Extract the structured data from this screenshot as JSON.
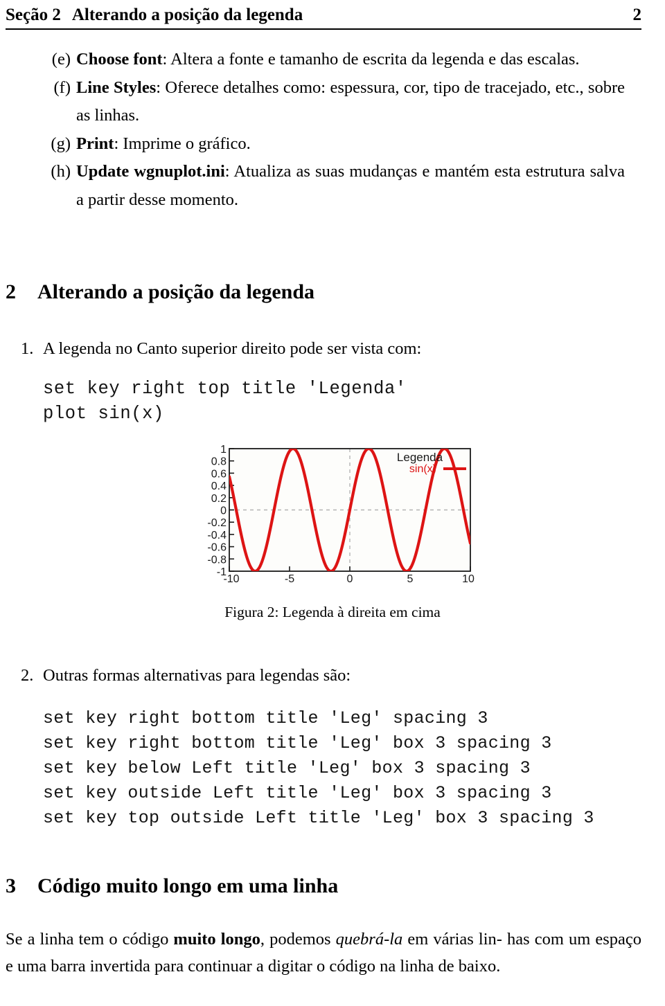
{
  "header": {
    "section_label": "Seção 2",
    "title": "Alterando a posição da legenda",
    "page_number": "2"
  },
  "lettered_list": [
    {
      "marker": "(e)",
      "bold": "Choose font",
      "rest": ": Altera a fonte e tamanho de escrita da legenda e das escalas."
    },
    {
      "marker": "(f)",
      "bold": "Line Styles",
      "rest": ": Oferece detalhes como: espessura, cor, tipo de tracejado, etc., sobre as linhas."
    },
    {
      "marker": "(g)",
      "bold": "Print",
      "rest": ": Imprime o gráfico."
    },
    {
      "marker": "(h)",
      "bold": "Update wgnuplot.ini",
      "rest": ": Atualiza as suas mudanças e mantém esta estrutura salva a partir desse momento."
    }
  ],
  "section_2": {
    "number": "2",
    "title": "Alterando a posição da legenda",
    "item_1": {
      "marker": "1.",
      "text": "A legenda no Canto superior direito pode ser vista com:"
    },
    "code_1": "set key right top title 'Legenda'\nplot sin(x)",
    "item_2": {
      "marker": "2.",
      "text": "Outras formas alternativas para legendas são:"
    },
    "code_2": "set key right bottom title 'Leg' spacing 3\nset key right bottom title 'Leg' box 3 spacing 3\nset key below Left title 'Leg' box 3 spacing 3\nset key outside Left title 'Leg' box 3 spacing 3\nset key top outside Left title 'Leg' box 3 spacing 3"
  },
  "figure": {
    "caption": "Figura 2: Legenda à direita em cima",
    "legend_title": "Legenda",
    "legend_entry": "sin(x)",
    "curve_color": "#dd1414",
    "frame_color": "#1a1a1a",
    "grid_color": "#b4b4b4",
    "plot_background": "#fdfdfb"
  },
  "section_3": {
    "number": "3",
    "title": "Código muito longo em uma linha"
  },
  "closing_paragraph": {
    "line_1_a": "Se a linha tem o código ",
    "line_1_bold": "muito longo",
    "line_1_b": ", podemos ",
    "line_1_italic": "quebrá-la",
    "line_1_c": " em várias lin-",
    "line_2": "has com um espaço e uma barra invertida para continuar a digitar o",
    "line_3": "código na linha de baixo."
  },
  "chart_data": {
    "type": "line",
    "title": "",
    "xlabel": "",
    "ylabel": "",
    "xlim": [
      -10,
      10
    ],
    "ylim": [
      -1,
      1
    ],
    "xticks": [
      -10,
      -5,
      0,
      5,
      10
    ],
    "yticks": [
      1,
      0.8,
      0.6,
      0.4,
      0.2,
      0,
      -0.2,
      -0.4,
      -0.6,
      -0.8,
      -1
    ],
    "xtick_labels": [
      "-10",
      "-5",
      "0",
      "5",
      "10"
    ],
    "ytick_labels": [
      "1",
      "0.8",
      "0.6",
      "0.4",
      "0.2",
      "0",
      "-0.2",
      "-0.4",
      "-0.6",
      "-0.8",
      "-1"
    ],
    "grid": true,
    "legend_position": "right top",
    "legend_title": "Legenda",
    "series": [
      {
        "name": "sin(x)",
        "color": "#dd1414",
        "function": "sin(x)",
        "x": [
          -10,
          -9.5,
          -9,
          -8.5,
          -8,
          -7.5,
          -7,
          -6.5,
          -6,
          -5.5,
          -5,
          -4.5,
          -4,
          -3.5,
          -3,
          -2.5,
          -2,
          -1.5,
          -1,
          -0.5,
          0,
          0.5,
          1,
          1.5,
          2,
          2.5,
          3,
          3.5,
          4,
          4.5,
          5,
          5.5,
          6,
          6.5,
          7,
          7.5,
          8,
          8.5,
          9,
          9.5,
          10
        ],
        "y": [
          0.544,
          0.075,
          -0.412,
          -0.798,
          -0.989,
          -0.938,
          -0.657,
          -0.215,
          0.279,
          0.706,
          0.959,
          0.978,
          0.757,
          0.351,
          -0.141,
          -0.598,
          -0.909,
          -0.997,
          -0.841,
          -0.479,
          0,
          0.479,
          0.841,
          0.997,
          0.909,
          0.598,
          0.141,
          -0.351,
          -0.757,
          -0.978,
          -0.959,
          -0.706,
          -0.279,
          0.215,
          0.657,
          0.938,
          0.989,
          0.798,
          0.412,
          -0.075,
          -0.544
        ]
      }
    ]
  }
}
